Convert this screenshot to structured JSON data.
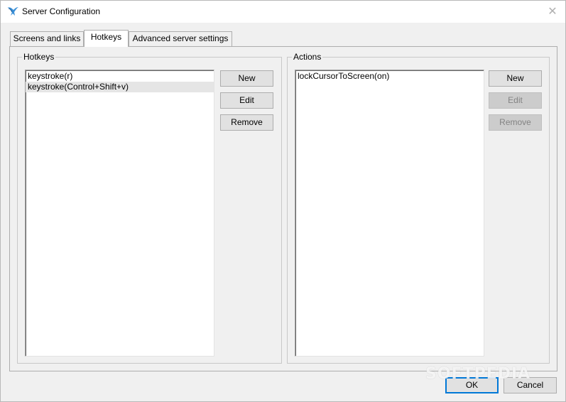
{
  "window": {
    "title": "Server Configuration",
    "close_glyph": "✕"
  },
  "tabs": [
    {
      "label": "Screens and links",
      "active": false
    },
    {
      "label": "Hotkeys",
      "active": true
    },
    {
      "label": "Advanced server settings",
      "active": false
    }
  ],
  "hotkeys": {
    "group_label": "Hotkeys",
    "items": [
      "keystroke(r)",
      "keystroke(Control+Shift+v)"
    ],
    "selected_index": 1,
    "buttons": {
      "new": "New",
      "edit": "Edit",
      "remove": "Remove"
    }
  },
  "actions": {
    "group_label": "Actions",
    "items": [
      "lockCursorToScreen(on)"
    ],
    "buttons": {
      "new": "New",
      "edit": "Edit",
      "remove": "Remove"
    },
    "edit_enabled": false,
    "remove_enabled": false
  },
  "footer": {
    "ok": "OK",
    "cancel": "Cancel"
  },
  "watermark": "SOFTPEDIA",
  "icons": {
    "app": "synergy-app-icon",
    "close": "close-icon"
  },
  "colors": {
    "accent": "#0078d7",
    "selection": "#e5e5e5",
    "background": "#f0f0f0"
  }
}
